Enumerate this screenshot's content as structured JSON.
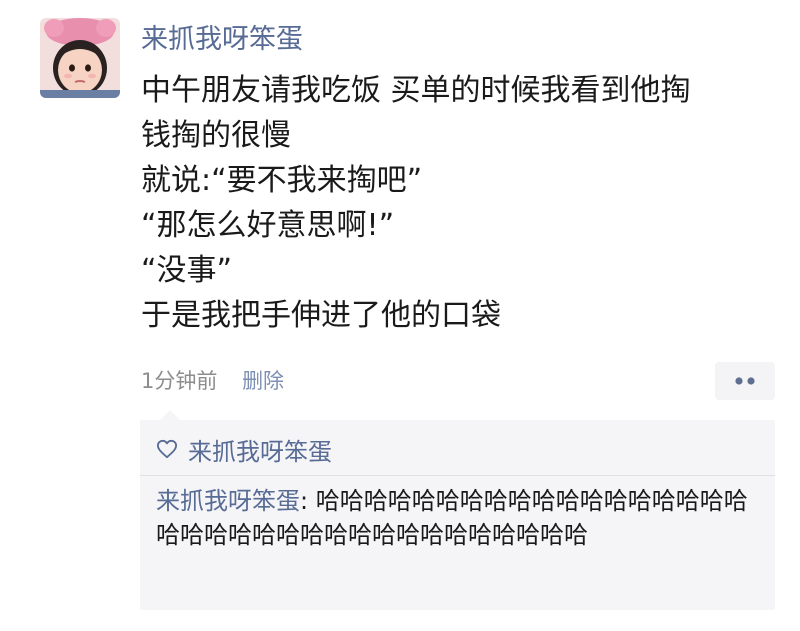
{
  "post": {
    "author": "来抓我呀笨蛋",
    "lines": [
      "中午朋友请我吃饭 买单的时候我看到他掏",
      "钱掏的很慢",
      "就说:“要不我来掏吧”",
      "“那怎么好意思啊!”",
      "“没事”",
      "于是我把手伸进了他的口袋"
    ],
    "time": "1分钟前",
    "delete_label": "删除"
  },
  "interactions": {
    "likes": "来抓我呀笨蛋",
    "comments": [
      {
        "author": "来抓我呀笨蛋",
        "separator": ": ",
        "text": "哈哈哈哈哈哈哈哈哈哈哈哈哈哈哈哈哈哈哈哈哈哈哈哈哈哈哈哈哈哈哈哈哈哈哈哈"
      }
    ]
  },
  "icons": {
    "more": "more-dots-icon",
    "like": "heart-outline-icon",
    "avatar": "avatar-image"
  },
  "colors": {
    "link": "#576b95",
    "text": "#1a1a1a",
    "meta": "#8d8d8d",
    "panel": "#f5f5f7"
  }
}
